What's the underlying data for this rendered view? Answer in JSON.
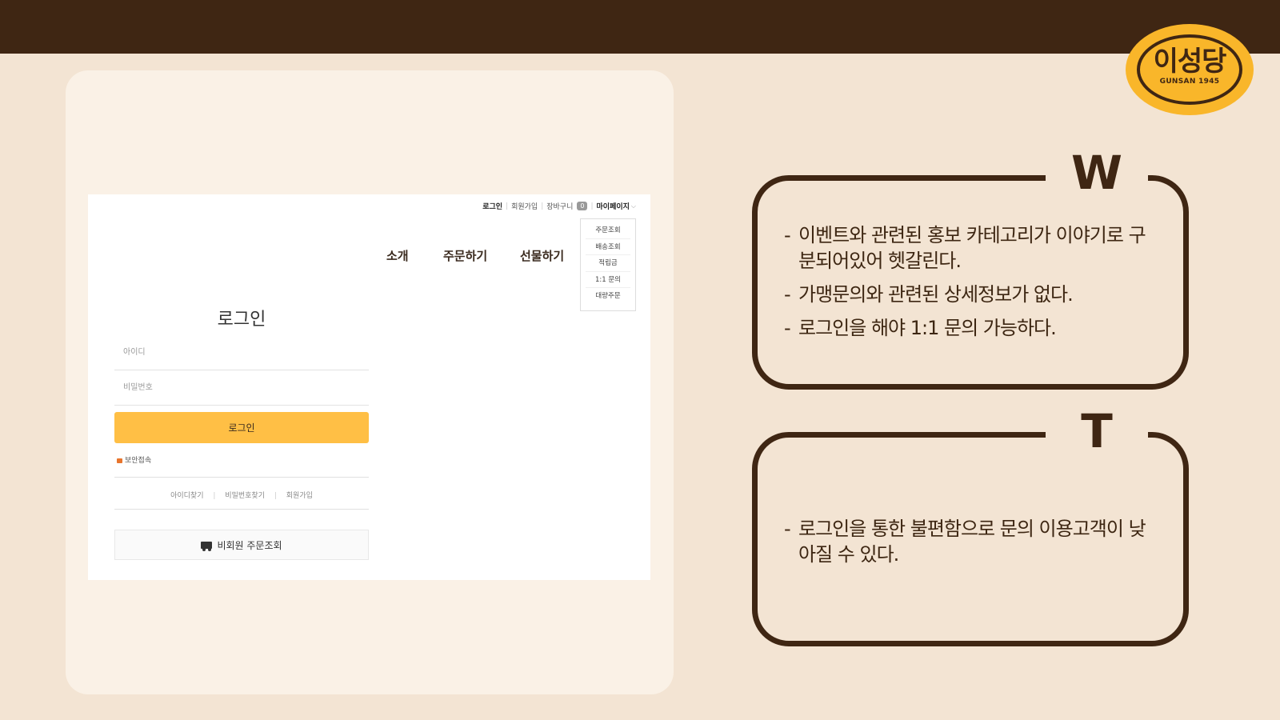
{
  "logo": {
    "title": "이성당",
    "subtitle": "GUNSAN 1945"
  },
  "site": {
    "utility": {
      "login": "로그인",
      "signup": "회원가입",
      "cart": "장바구니",
      "cart_count": "0",
      "mypage": "마이페이지"
    },
    "mypage_menu": [
      "주문조회",
      "배송조회",
      "적립금",
      "1:1 문의",
      "대량주문"
    ],
    "nav": [
      "소개",
      "주문하기",
      "선물하기"
    ],
    "login": {
      "title": "로그인",
      "id_placeholder": "아이디",
      "pw_placeholder": "비밀번호",
      "button": "로그인",
      "secure": "보안접속",
      "find_id": "아이디찾기",
      "find_pw": "비밀번호찾기",
      "join": "회원가입",
      "guest_order": "비회원 주문조회"
    }
  },
  "weakness": {
    "letter": "W",
    "items": [
      "이벤트와 관련된 홍보 카테고리가 이야기로 구분되어있어 헷갈린다.",
      "가맹문의와 관련된 상세정보가 없다.",
      "로그인을 해야 1:1 문의 가능하다."
    ]
  },
  "threat": {
    "letter": "T",
    "items": [
      "로그인을 통한 불편함으로 문의 이용고객이 낮아질 수 있다."
    ]
  }
}
